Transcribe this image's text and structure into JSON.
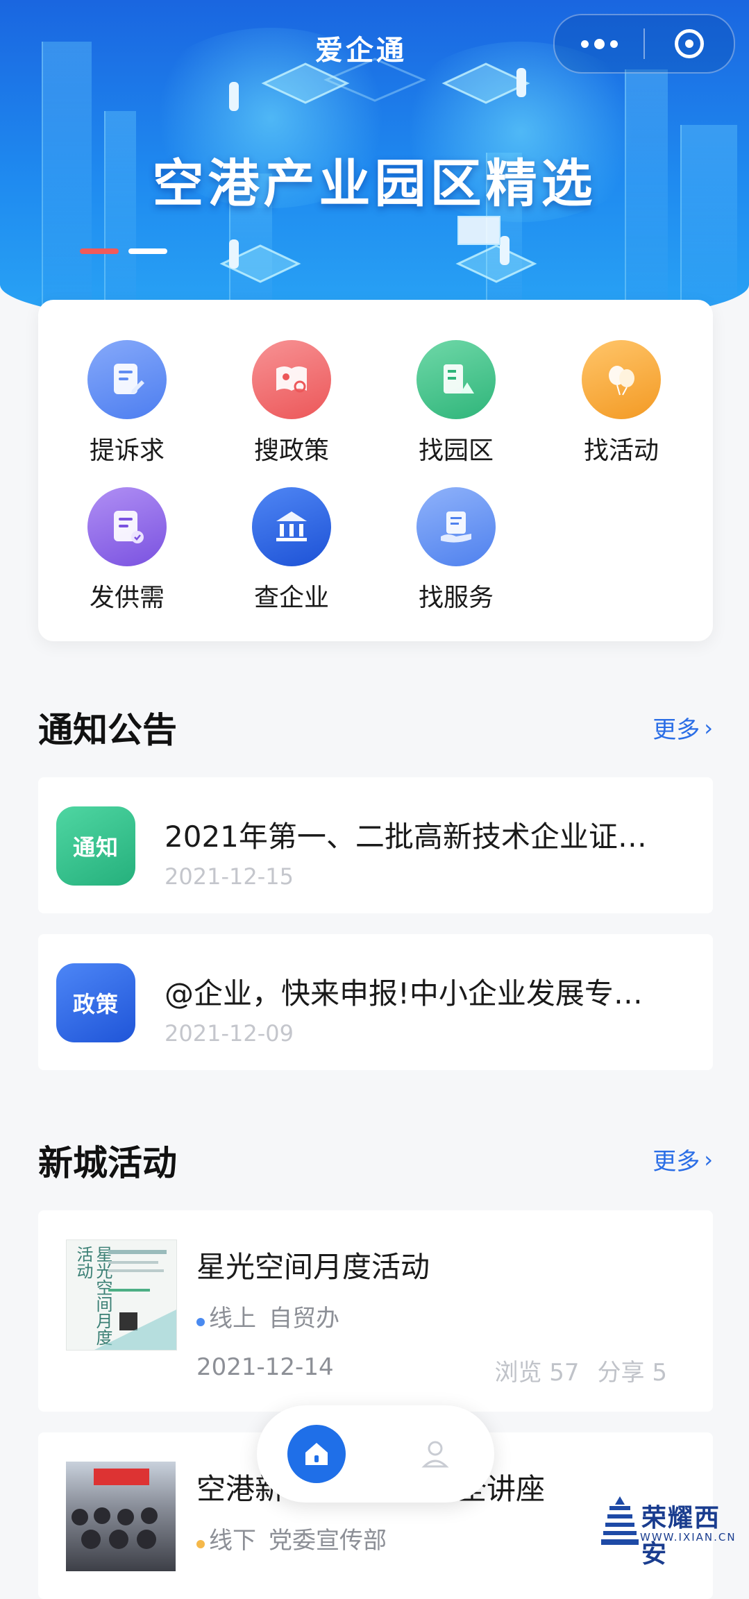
{
  "app": {
    "title": "爱企通"
  },
  "banner": {
    "headline": "空港产业园区精选"
  },
  "quick_menu": [
    {
      "label": "提诉求",
      "icon": "edit-doc-icon",
      "color": "#5f8cf2"
    },
    {
      "label": "搜政策",
      "icon": "policy-book-icon",
      "color": "#f0676a"
    },
    {
      "label": "找园区",
      "icon": "park-building-icon",
      "color": "#3dbf86"
    },
    {
      "label": "找活动",
      "icon": "balloon-icon",
      "color": "#f6a63a"
    },
    {
      "label": "发供需",
      "icon": "supply-doc-icon",
      "color": "#8c65e6"
    },
    {
      "label": "查企业",
      "icon": "bank-icon",
      "color": "#2f66e0"
    },
    {
      "label": "找服务",
      "icon": "service-hand-icon",
      "color": "#5f8cf2"
    }
  ],
  "notices": {
    "title": "通知公告",
    "more": "更多",
    "items": [
      {
        "badge": "通知",
        "badge_color": "#2fbf8a",
        "title": "2021年第一、二批高新技术企业证…",
        "date": "2021-12-15"
      },
      {
        "badge": "政策",
        "badge_color": "#2f66e0",
        "title": "@企业，快来申报!中小企业发展专…",
        "date": "2021-12-09"
      }
    ]
  },
  "events": {
    "title": "新城活动",
    "more": "更多",
    "items": [
      {
        "title": "星光空间月度活动",
        "mode": "线上",
        "mode_color": "#4a8af0",
        "organizer": "自贸办",
        "date": "2021-12-14",
        "views_label": "浏览 57",
        "shares_label": "分享 5",
        "poster_text": "星光空间月度活动"
      },
      {
        "title": "空港新",
        "title_tail": "全讲座",
        "mode": "线下",
        "mode_color": "#f5b84a",
        "organizer": "党委宣传部"
      }
    ]
  },
  "watermark": {
    "text": "荣耀西安",
    "url": "WWW.IXIAN.CN"
  }
}
